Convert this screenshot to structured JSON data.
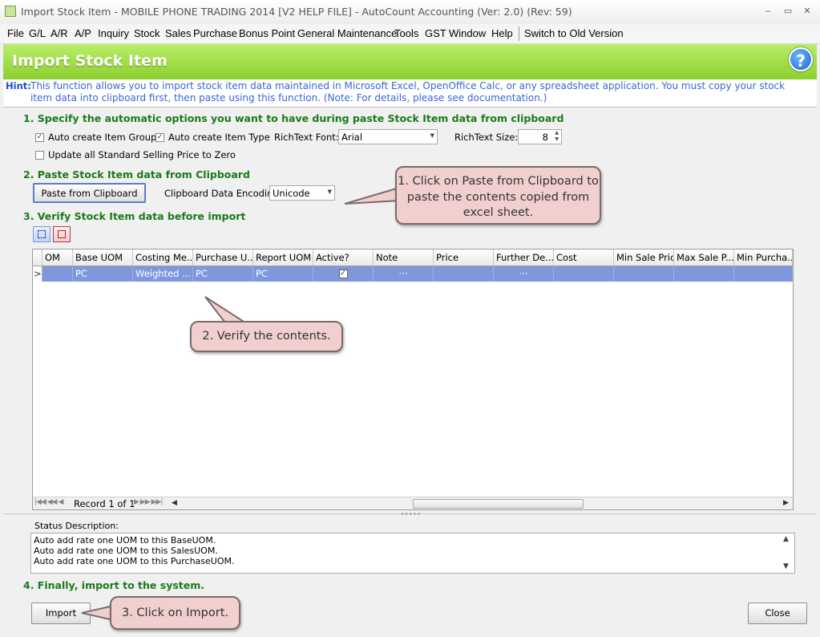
{
  "window": {
    "title": "Import Stock Item - MOBILE PHONE TRADING 2014 [V2 HELP FILE] - AutoCount Accounting (Ver: 2.0) (Rev: 59)",
    "controls": [
      "‒",
      "▭",
      "✕"
    ]
  },
  "menu": [
    "File",
    "G/L",
    "A/R",
    "A/P",
    "Inquiry",
    "Stock",
    "Sales",
    "Purchase",
    "Bonus Point",
    "General Maintenance",
    "Tools",
    "GST",
    "Window",
    "Help",
    "Switch to Old Version"
  ],
  "header": {
    "title": "Import Stock Item",
    "help": "?"
  },
  "hint": {
    "label": "Hint:",
    "text": "This function allows you to import stock item data maintained in Microsoft Excel, OpenOffice Calc, or any spreadsheet application. You must copy your stock item data into clipboard first, then paste using this function. (Note: For details, please see documentation.)"
  },
  "section1": {
    "heading": "1. Specify the automatic options you want to have during paste Stock Item data from clipboard",
    "auto_item_group": "Auto create Item Group",
    "auto_item_type": "Auto create Item Type",
    "richtext_font_label": "RichText Font:",
    "richtext_font_value": "Arial",
    "richtext_size_label": "RichText Size:",
    "richtext_size_value": "8",
    "update_price": "Update all Standard Selling Price to Zero"
  },
  "section2": {
    "heading": "2. Paste Stock Item data from Clipboard",
    "paste_button": "Paste from Clipboard",
    "encoding_label": "Clipboard Data Encoding:",
    "encoding_value": "Unicode"
  },
  "section3": {
    "heading": "3. Verify Stock Item data before import"
  },
  "grid": {
    "columns": [
      "OM",
      "Base UOM",
      "Costing Me...",
      "Purchase U...",
      "Report UOM",
      "Active?",
      "Note",
      "Price",
      "Further De...",
      "Cost",
      "Min Sale Price",
      "Max Sale P...",
      "Min Purcha..."
    ],
    "row": {
      "indicator": ">",
      "base_uom": "PC",
      "costing": "Weighted ...",
      "purchase_uom": "PC",
      "report_uom": "PC",
      "active": "✓",
      "note": "···",
      "further": "···"
    },
    "record_text": "Record 1 of 1"
  },
  "status": {
    "label": "Status Description:",
    "lines": [
      "Auto add rate one UOM to this BaseUOM.",
      "Auto add rate one UOM to this SalesUOM.",
      "Auto add rate one UOM to this PurchaseUOM."
    ]
  },
  "section4": {
    "heading": "4. Finally, import to the system."
  },
  "buttons": {
    "import": "Import",
    "close": "Close"
  },
  "callouts": {
    "c1": "1. Click on Paste from Clipboard to paste the contents copied from excel sheet.",
    "c2": "2. Verify the contents.",
    "c3": "3. Click on Import."
  }
}
